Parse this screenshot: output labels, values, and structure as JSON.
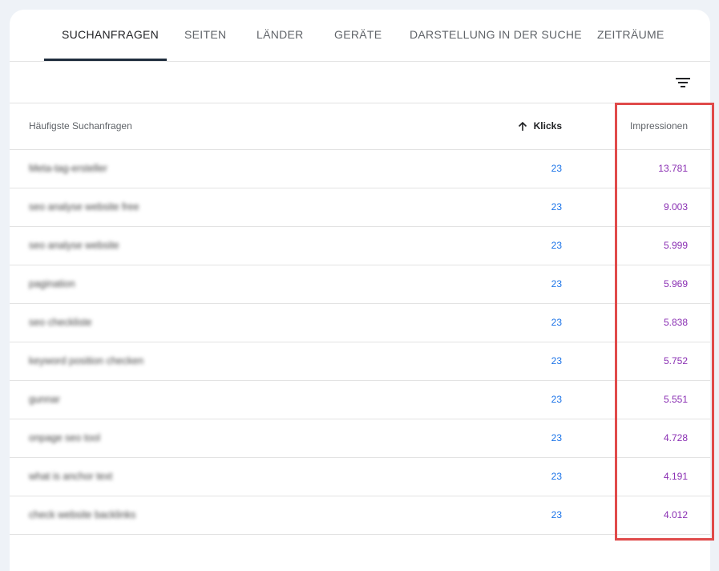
{
  "tabs": [
    {
      "label": "SUCHANFRAGEN",
      "active": true
    },
    {
      "label": "SEITEN",
      "active": false
    },
    {
      "label": "LÄNDER",
      "active": false
    },
    {
      "label": "GERÄTE",
      "active": false
    },
    {
      "label": "DARSTELLUNG IN DER SUCHE",
      "active": false
    },
    {
      "label": "ZEITRÄUME",
      "active": false
    }
  ],
  "toolbar": {
    "filter_icon": "filter-list-icon"
  },
  "table": {
    "headers": {
      "query": "Häufigste Suchanfragen",
      "clicks": "Klicks",
      "impressions": "Impressionen"
    },
    "sort": {
      "column": "clicks",
      "direction": "ascending",
      "icon": "arrow-up-icon"
    },
    "rows": [
      {
        "query": "Meta-tag-ersteller",
        "clicks": "23",
        "impressions": "13.781"
      },
      {
        "query": "seo analyse website free",
        "clicks": "23",
        "impressions": "9.003"
      },
      {
        "query": "seo analyse website",
        "clicks": "23",
        "impressions": "5.999"
      },
      {
        "query": "pagination",
        "clicks": "23",
        "impressions": "5.969"
      },
      {
        "query": "seo checkliste",
        "clicks": "23",
        "impressions": "5.838"
      },
      {
        "query": "keyword position checken",
        "clicks": "23",
        "impressions": "5.752"
      },
      {
        "query": "gunnar",
        "clicks": "23",
        "impressions": "5.551"
      },
      {
        "query": "onpage seo tool",
        "clicks": "23",
        "impressions": "4.728"
      },
      {
        "query": "what is anchor text",
        "clicks": "23",
        "impressions": "4.191"
      },
      {
        "query": "check website backlinks",
        "clicks": "23",
        "impressions": "4.012"
      }
    ]
  },
  "colors": {
    "clicks": "#1a73e8",
    "impressions": "#8a2fb3",
    "highlight": "#e04a4a",
    "tab_indicator": "#1f2d3d"
  }
}
